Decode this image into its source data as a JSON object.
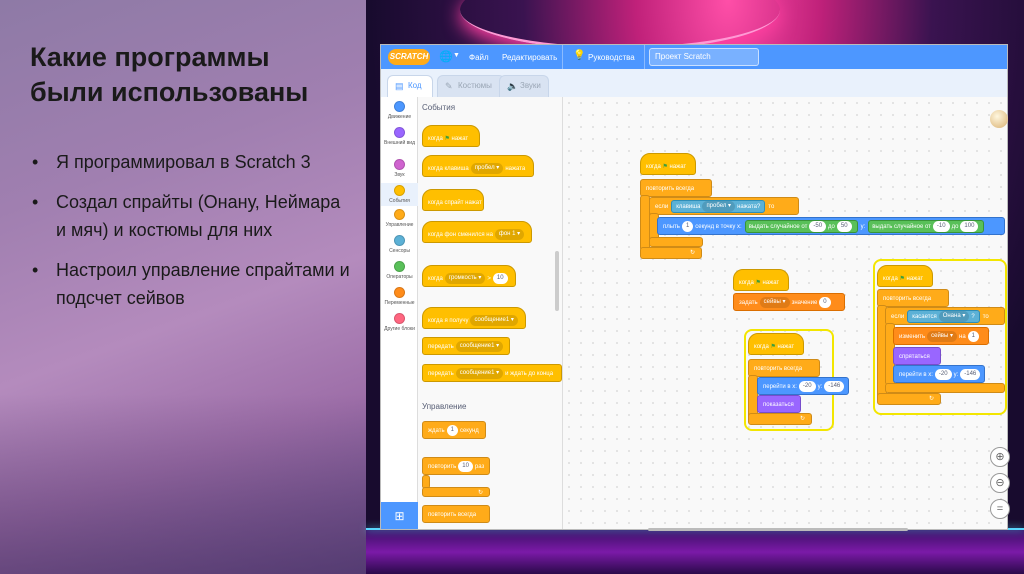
{
  "slide": {
    "title": "Какие программы были использованы",
    "bullets": [
      "Я программировал в Scratch 3",
      "Создал спрайты (Онану, Неймара и мяч) и костюмы для них",
      "Настроил управление спрайтами и подсчет сейвов"
    ]
  },
  "menubar": {
    "logo": "SCRATCH",
    "file": "Файл",
    "edit": "Редактировать",
    "tutorials": "Руководства",
    "project_title": "Проект Scratch"
  },
  "tabs": [
    "Код",
    "Костюмы",
    "Звуки"
  ],
  "categories": [
    {
      "label": "Движение",
      "color": "#4c97ff"
    },
    {
      "label": "Внешний вид",
      "color": "#9966ff"
    },
    {
      "label": "Звук",
      "color": "#cf63cf"
    },
    {
      "label": "События",
      "color": "#ffbf00"
    },
    {
      "label": "Управление",
      "color": "#ffab19"
    },
    {
      "label": "Сенсоры",
      "color": "#5cb1d6"
    },
    {
      "label": "Операторы",
      "color": "#59c059"
    },
    {
      "label": "Переменные",
      "color": "#ff8c1a"
    },
    {
      "label": "Другие блоки",
      "color": "#ff6680"
    }
  ],
  "palette": {
    "events_header": "События",
    "control_header": "Управление",
    "when_flag": "когда",
    "clicked": "нажат",
    "when_key": "когда клавиша",
    "key_space": "пробел",
    "key_pressed": "нажата",
    "when_sprite_clicked": "когда спрайт нажат",
    "when_backdrop": "когда фон сменился на",
    "backdrop1": "фон 1",
    "when": "когда",
    "loudness": "громкость",
    "gt": ">",
    "ten": "10",
    "when_receive": "когда я получу",
    "message1": "сообщение1",
    "broadcast": "передать",
    "broadcast_wait": "передать",
    "and_wait": "и ждать до конца",
    "wait": "ждать",
    "wait_val": "1",
    "seconds": "секунд",
    "repeat": "повторить",
    "repeat_val": "10",
    "times": "раз",
    "forever": "повторить всегда"
  },
  "script1": {
    "hat": "когда",
    "clicked": "нажат",
    "forever": "повторить всегда",
    "if": "если",
    "key": "клавиша",
    "space": "пробел",
    "pressed": "нажата?",
    "then": "то",
    "glide": "плыть",
    "glide_val": "1",
    "glide_to": "секунд в точку x:",
    "rand1": "выдать случайное от",
    "r1a": "-50",
    "to1": "до",
    "r1b": "50",
    "y": "y:",
    "rand2": "выдать случайное от",
    "r2a": "-10",
    "to2": "до",
    "r2b": "100"
  },
  "script2": {
    "hat": "когда",
    "clicked": "нажат",
    "set": "задать",
    "var": "сейвы",
    "value": "значение",
    "val": "0"
  },
  "script3": {
    "hat": "когда",
    "clicked": "нажат",
    "forever": "повторить всегда",
    "goto": "перейти в x:",
    "x": "-20",
    "y": "y:",
    "yv": "-146",
    "show": "показаться"
  },
  "script4": {
    "hat": "когда",
    "clicked": "нажат",
    "forever": "повторить всегда",
    "if": "если",
    "touching": "касается",
    "target": "Онана",
    "q": "?",
    "then": "то",
    "change": "изменить",
    "var": "сейвы",
    "by": "на",
    "by_val": "1",
    "hide": "спрятаться",
    "goto": "перейти в x:",
    "x": "-20",
    "y": "y:",
    "yv": "-146"
  }
}
